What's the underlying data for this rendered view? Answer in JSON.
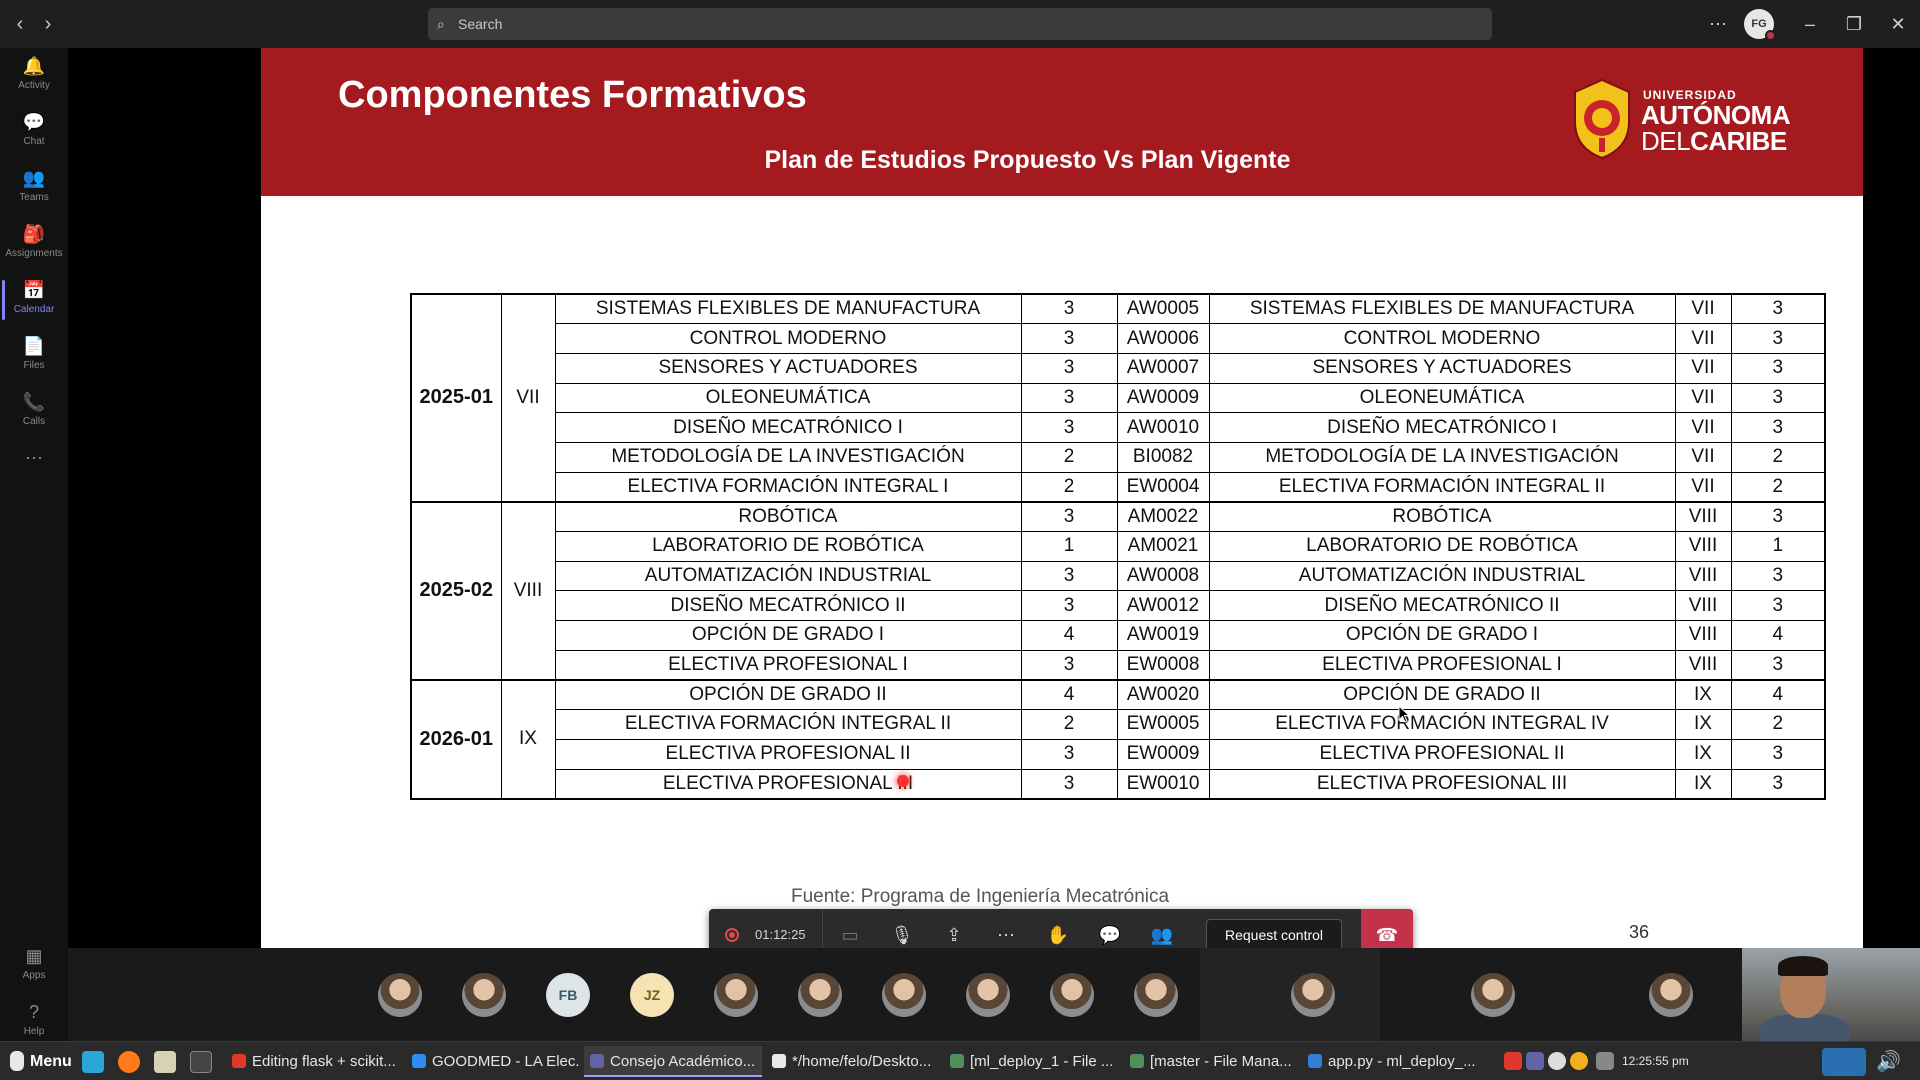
{
  "titlebar": {
    "search_placeholder": "Search",
    "back_icon": "‹",
    "forward_icon": "›",
    "more_icon": "⋯",
    "avatar_initials": "FG",
    "minimize_icon": "–",
    "restore_icon": "❐",
    "close_icon": "✕"
  },
  "rail": {
    "items": [
      {
        "label": "Activity",
        "icon": "bell-icon",
        "glyph": "🔔"
      },
      {
        "label": "Chat",
        "icon": "chat-icon",
        "glyph": "💬"
      },
      {
        "label": "Teams",
        "icon": "teams-icon",
        "glyph": "👥"
      },
      {
        "label": "Assignments",
        "icon": "assignments-icon",
        "glyph": "🎒"
      },
      {
        "label": "Calendar",
        "icon": "calendar-icon",
        "glyph": "📅"
      },
      {
        "label": "Files",
        "icon": "files-icon",
        "glyph": "📄"
      },
      {
        "label": "Calls",
        "icon": "calls-icon",
        "glyph": "📞"
      },
      {
        "label": "",
        "icon": "more-icon",
        "glyph": "⋯"
      }
    ],
    "apps_label": "Apps",
    "help_label": "Help"
  },
  "slide": {
    "title": "Componentes Formativos",
    "subtitle": "Plan de Estudios Propuesto Vs Plan Vigente",
    "logo": {
      "line1": "UNIVERSIDAD",
      "line2": "AUTÓNOMA",
      "line3a": "DEL",
      "line3b": "CARIBE"
    },
    "source_text": "Fuente: Programa de Ingeniería Mecatrónica",
    "page_number": "36",
    "groups": [
      {
        "term": "2025-01",
        "semester": "VII",
        "rows": [
          [
            "SISTEMAS FLEXIBLES DE MANUFACTURA",
            "3",
            "AW0005",
            "SISTEMAS FLEXIBLES DE MANUFACTURA",
            "VII",
            "3"
          ],
          [
            "CONTROL MODERNO",
            "3",
            "AW0006",
            "CONTROL MODERNO",
            "VII",
            "3"
          ],
          [
            "SENSORES Y ACTUADORES",
            "3",
            "AW0007",
            "SENSORES Y ACTUADORES",
            "VII",
            "3"
          ],
          [
            "OLEONEUMÁTICA",
            "3",
            "AW0009",
            "OLEONEUMÁTICA",
            "VII",
            "3"
          ],
          [
            "DISEÑO MECATRÓNICO I",
            "3",
            "AW0010",
            "DISEÑO MECATRÓNICO I",
            "VII",
            "3"
          ],
          [
            "METODOLOGÍA DE LA INVESTIGACIÓN",
            "2",
            "BI0082",
            "METODOLOGÍA DE LA INVESTIGACIÓN",
            "VII",
            "2"
          ],
          [
            "ELECTIVA FORMACIÓN INTEGRAL I",
            "2",
            "EW0004",
            "ELECTIVA FORMACIÓN INTEGRAL II",
            "VII",
            "2"
          ]
        ]
      },
      {
        "term": "2025-02",
        "semester": "VIII",
        "rows": [
          [
            "ROBÓTICA",
            "3",
            "AM0022",
            "ROBÓTICA",
            "VIII",
            "3"
          ],
          [
            "LABORATORIO DE ROBÓTICA",
            "1",
            "AM0021",
            "LABORATORIO DE ROBÓTICA",
            "VIII",
            "1"
          ],
          [
            "AUTOMATIZACIÓN INDUSTRIAL",
            "3",
            "AW0008",
            "AUTOMATIZACIÓN INDUSTRIAL",
            "VIII",
            "3"
          ],
          [
            "DISEÑO MECATRÓNICO II",
            "3",
            "AW0012",
            "DISEÑO MECATRÓNICO II",
            "VIII",
            "3"
          ],
          [
            "OPCIÓN DE GRADO I",
            "4",
            "AW0019",
            "OPCIÓN DE GRADO I",
            "VIII",
            "4"
          ],
          [
            "ELECTIVA PROFESIONAL I",
            "3",
            "EW0008",
            "ELECTIVA PROFESIONAL I",
            "VIII",
            "3"
          ]
        ]
      },
      {
        "term": "2026-01",
        "semester": "IX",
        "rows": [
          [
            "OPCIÓN DE GRADO II",
            "4",
            "AW0020",
            "OPCIÓN DE GRADO II",
            "IX",
            "4"
          ],
          [
            "ELECTIVA FORMACIÓN INTEGRAL II",
            "2",
            "EW0005",
            "ELECTIVA FORMACIÓN INTEGRAL IV",
            "IX",
            "2"
          ],
          [
            "ELECTIVA PROFESIONAL II",
            "3",
            "EW0009",
            "ELECTIVA PROFESIONAL II",
            "IX",
            "3"
          ],
          [
            "ELECTIVA PROFESIONAL III",
            "3",
            "EW0010",
            "ELECTIVA PROFESIONAL III",
            "IX",
            "3"
          ]
        ]
      }
    ]
  },
  "call_controls": {
    "timer": "01:12:25",
    "request_control_label": "Request control"
  },
  "participants": [
    {
      "type": "photo"
    },
    {
      "type": "photo"
    },
    {
      "type": "initials",
      "initials": "FB",
      "bg": "#dde5e8",
      "fg": "#3d5a64"
    },
    {
      "type": "initials",
      "initials": "JZ",
      "bg": "#f6e3b4",
      "fg": "#7a5b10"
    },
    {
      "type": "photo"
    },
    {
      "type": "photo"
    },
    {
      "type": "photo"
    },
    {
      "type": "photo"
    },
    {
      "type": "photo"
    },
    {
      "type": "photo"
    },
    {
      "type": "photo"
    },
    {
      "type": "photo"
    },
    {
      "type": "photo"
    }
  ],
  "taskbar": {
    "menu_label": "Menu",
    "tasks": [
      {
        "label": "Editing flask + scikit...",
        "color": "#e0392b"
      },
      {
        "label": "GOODMED - LA Elec...",
        "color": "#2d8cf0"
      },
      {
        "label": "Consejo Académico...",
        "color": "#6264a7",
        "active": true
      },
      {
        "label": "*/home/felo/Deskto...",
        "color": "#e8e8e8"
      },
      {
        "label": "[ml_deploy_1 - File ...",
        "color": "#4f8f5a"
      },
      {
        "label": "[master - File Mana...",
        "color": "#4f8f5a"
      },
      {
        "label": "app.py - ml_deploy_...",
        "color": "#2f7fd6"
      }
    ],
    "clock": "12:25:55 pm"
  }
}
